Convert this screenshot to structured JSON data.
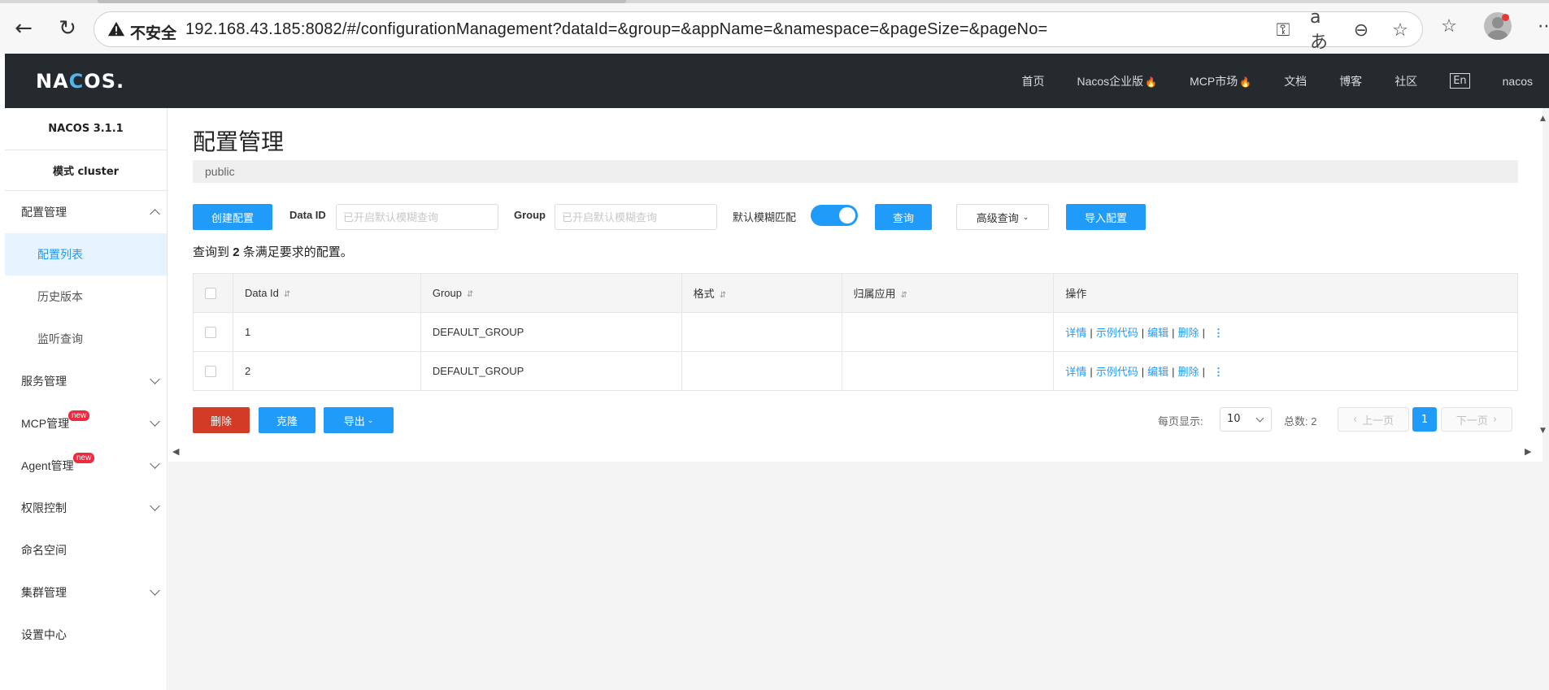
{
  "browser": {
    "insecure_label": "不安全",
    "url": "192.168.43.185:8082/#/configurationManagement?dataId=&group=&appName=&namespace=&pageSize=&pageNo="
  },
  "header": {
    "logo_pre": "NA",
    "logo_c": "C",
    "logo_post": "OS.",
    "nav": {
      "home": "首页",
      "enterprise": "Nacos企业版",
      "mcp_market": "MCP市场",
      "docs": "文档",
      "blog": "博客",
      "community": "社区",
      "lang": "En",
      "user": "nacos"
    }
  },
  "sidebar": {
    "version": "NACOS 3.1.1",
    "mode": "模式 cluster",
    "config_mgmt": "配置管理",
    "config_list": "配置列表",
    "history": "历史版本",
    "listen_query": "监听查询",
    "service_mgmt": "服务管理",
    "mcp_mgmt": "MCP管理",
    "agent_mgmt": "Agent管理",
    "new_badge": "new",
    "auth": "权限控制",
    "namespace": "命名空间",
    "cluster": "集群管理",
    "settings": "设置中心"
  },
  "main": {
    "title": "配置管理",
    "namespace": "public",
    "create_btn": "创建配置",
    "dataid_label": "Data ID",
    "dataid_placeholder": "已开启默认模糊查询",
    "group_label": "Group",
    "group_placeholder": "已开启默认模糊查询",
    "fuzzy_label": "默认模糊匹配",
    "query_btn": "查询",
    "advanced_btn": "高级查询",
    "import_btn": "导入配置",
    "result_pre": "查询到",
    "result_count": "2",
    "result_post": "条满足要求的配置。",
    "columns": {
      "dataid": "Data Id",
      "group": "Group",
      "format": "格式",
      "app": "归属应用",
      "ops": "操作"
    },
    "rows": [
      {
        "dataid": "1",
        "group": "DEFAULT_GROUP",
        "format": "",
        "app": ""
      },
      {
        "dataid": "2",
        "group": "DEFAULT_GROUP",
        "format": "",
        "app": ""
      }
    ],
    "ops": {
      "detail": "详情",
      "sample": "示例代码",
      "edit": "编辑",
      "delete": "删除",
      "sep": "|"
    },
    "delete_btn": "删除",
    "clone_btn": "克隆",
    "export_btn": "导出",
    "pagination": {
      "per_page_label": "每页显示:",
      "per_page_value": "10",
      "total_label": "总数:",
      "total_value": "2",
      "prev": "上一页",
      "current": "1",
      "next": "下一页"
    }
  }
}
